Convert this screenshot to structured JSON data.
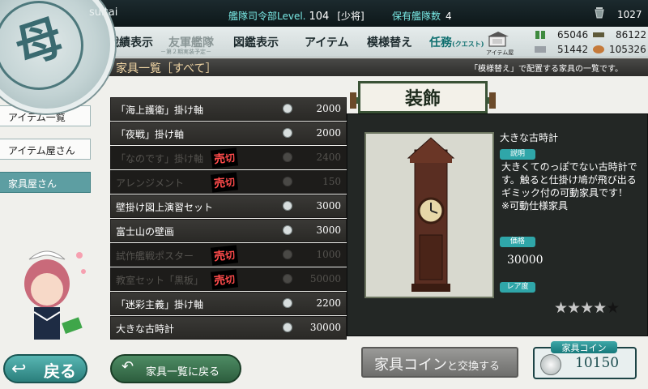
{
  "topbar": {
    "username": "suitai",
    "admiral_label": "艦隊司令部Level.",
    "admiral_level": "104",
    "rank": "[少将]",
    "ships_label": "保有艦隊数",
    "ships_count": "4",
    "repair_buckets": "1027"
  },
  "nav": {
    "records": "戦績表示",
    "friend_fleet": "友軍艦隊",
    "friend_sub": "－第２期実装予定－",
    "encyclopedia": "図鑑表示",
    "items": "アイテム",
    "remodel": "模様替え",
    "quest": "任務",
    "quest_sub": "(クエスト)",
    "item_shop": "アイテム屋"
  },
  "resources": {
    "fuel": "65046",
    "ammo": "86122",
    "steel": "51442",
    "bauxite": "105326"
  },
  "header": {
    "title": "家具一覧［すべて］",
    "note": "「模様替え」で配置する家具の一覧です。"
  },
  "sidebar": {
    "items": [
      {
        "label": "アイテム一覧"
      },
      {
        "label": "アイテム屋さん"
      },
      {
        "label": "家具屋さん"
      }
    ]
  },
  "furniture_list": [
    {
      "name": "「海上護衛」掛け軸",
      "price": "2000",
      "soldout": false
    },
    {
      "name": "「夜戦」掛け軸",
      "price": "2000",
      "soldout": false
    },
    {
      "name": "「なのです」掛け軸",
      "price": "2400",
      "soldout": true
    },
    {
      "name": "アレンジメント",
      "price": "150",
      "soldout": true
    },
    {
      "name": "壁掛け図上演習セット",
      "price": "3000",
      "soldout": false
    },
    {
      "name": "富士山の壁画",
      "price": "3000",
      "soldout": false
    },
    {
      "name": "試作艦戦ポスター",
      "price": "1000",
      "soldout": true
    },
    {
      "name": "教室セット「黒板」",
      "price": "50000",
      "soldout": true
    },
    {
      "name": "「迷彩主義」掛け軸",
      "price": "2200",
      "soldout": false
    },
    {
      "name": "大きな古時計",
      "price": "30000",
      "soldout": false
    }
  ],
  "soldout_label": "売",
  "soldout_label2": "切",
  "detail": {
    "category": "装飾",
    "name": "大きな古時計",
    "desc_tag": "説明",
    "description": "大きくてのっぽでない古時計です。触ると仕掛け鳩が飛び出るギミック付の可動家具です！\n※可動仕様家具",
    "price_tag": "価格",
    "price": "30000",
    "rarity_tag": "レア度",
    "rarity": "4 of 5 stars",
    "stars_on": "★★★★",
    "stars_off": "★"
  },
  "bottom": {
    "back": "戻る",
    "list_back": "家具一覧に戻る",
    "exchange_main": "家具コイン",
    "exchange_sub": "と交換する",
    "coin_label": "家具コイン",
    "coin_value": "10150"
  },
  "colors": {
    "accent_teal": "#2fa6a9",
    "soldout_red": "#ff4b4b",
    "topbar_text": "#79e8e4"
  }
}
